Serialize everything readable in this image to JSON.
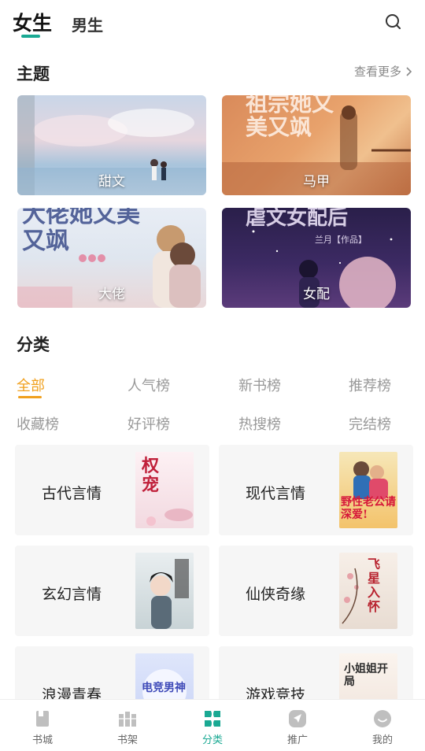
{
  "header": {
    "tab_female": "女生",
    "tab_male": "男生",
    "search_icon": "search-icon"
  },
  "themes": {
    "title": "主题",
    "see_more": "查看更多",
    "items": [
      {
        "label": "甜文",
        "deco": ""
      },
      {
        "label": "马甲",
        "deco": "祖宗她又美又飒"
      },
      {
        "label": "大佬",
        "deco": "大佬她又美又飒"
      },
      {
        "label": "女配",
        "deco": "虐文女配后",
        "author": "兰月【作品】"
      }
    ]
  },
  "categories": {
    "title": "分类",
    "tabs": [
      "全部",
      "人气榜",
      "新书榜",
      "推荐榜",
      "收藏榜",
      "好评榜",
      "热搜榜",
      "完结榜"
    ],
    "active_tab": "全部"
  },
  "genres": [
    {
      "name": "古代言情",
      "cover_text": "权宠"
    },
    {
      "name": "现代言情",
      "cover_text": "野性老公请深爱!"
    },
    {
      "name": "玄幻言情",
      "cover_text": ""
    },
    {
      "name": "仙侠奇缘",
      "cover_text": "飞星入怀"
    },
    {
      "name": "浪漫青春",
      "cover_text": "电竞男神"
    },
    {
      "name": "游戏竞技",
      "cover_text": "小姐姐开局"
    }
  ],
  "nav": {
    "items": [
      {
        "label": "书城",
        "icon": "book-icon"
      },
      {
        "label": "书架",
        "icon": "bookshelf-icon"
      },
      {
        "label": "分类",
        "icon": "category-icon"
      },
      {
        "label": "推广",
        "icon": "promote-icon"
      },
      {
        "label": "我的",
        "icon": "profile-icon"
      }
    ],
    "active": "分类"
  },
  "colors": {
    "accent_green": "#1aa993",
    "accent_orange": "#f0a01e"
  }
}
